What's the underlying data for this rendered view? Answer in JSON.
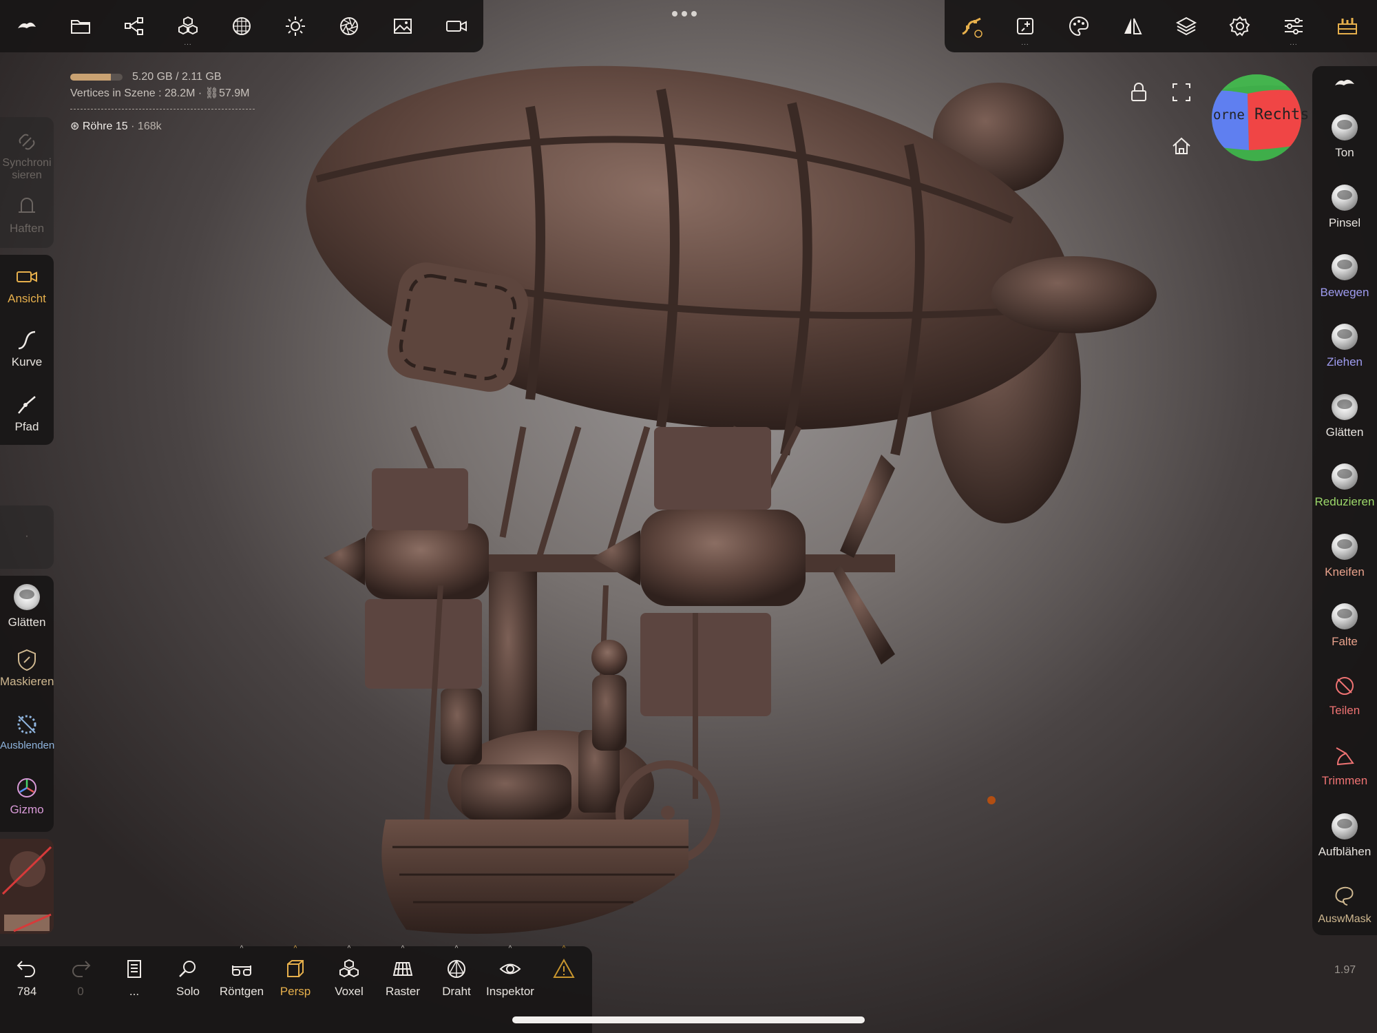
{
  "colors": {
    "accent": "#e7b04c",
    "panel": "#181616",
    "mask": "#cfb890",
    "hide": "#8fb4dd",
    "gizmo": "#d99ad8",
    "move": "#9f9cf0",
    "reduce": "#9cd86a",
    "pinch": "#e9a28c",
    "split": "#ef7373"
  },
  "top_left_tools": [
    "nomad-logo-icon",
    "folder-icon",
    "scene-graph-icon",
    "cubes-icon",
    "sphere-grid-icon",
    "sun-icon",
    "aperture-icon",
    "image-icon",
    "camera-icon"
  ],
  "top_right_tools": [
    "curve-tool-icon",
    "topology-icon",
    "palette-icon",
    "symmetry-icon",
    "layers-icon",
    "gear-icon",
    "sliders-icon",
    "interface-icon"
  ],
  "info": {
    "memory": "5.20 GB / 2.11 GB",
    "memory_fill": 0.78,
    "vertices_label": "Vertices in Szene :",
    "vertices_value": "28.2M",
    "linked_value": "57.9M",
    "object_name": "Röhre 15",
    "object_count": "· 168k"
  },
  "left": {
    "sync": "Synchroni sieren",
    "stick": "Haften",
    "view": "Ansicht",
    "curve": "Kurve",
    "path": "Pfad",
    "dot": "·",
    "smooth": "Glätten",
    "mask": "Maskieren",
    "hide": "Ausblenden",
    "gizmo": "Gizmo"
  },
  "right": {
    "tone": "Ton",
    "brush": "Pinsel",
    "move": "Bewegen",
    "drag": "Ziehen",
    "smooth": "Glätten",
    "reduce": "Reduzieren",
    "pinch": "Kneifen",
    "crease": "Falte",
    "split": "Teilen",
    "trim": "Trimmen",
    "inflate": "Aufblähen",
    "select_mask": "AuswMask"
  },
  "cube": {
    "right": "Rechts",
    "front": "orne"
  },
  "bottom": {
    "undo_count": "784",
    "redo_count": "0",
    "file_more": "...",
    "solo": "Solo",
    "xray": "Röntgen",
    "persp": "Persp",
    "voxel": "Voxel",
    "grid": "Raster",
    "wire": "Draht",
    "inspector": "Inspektor"
  },
  "version": "1.97"
}
